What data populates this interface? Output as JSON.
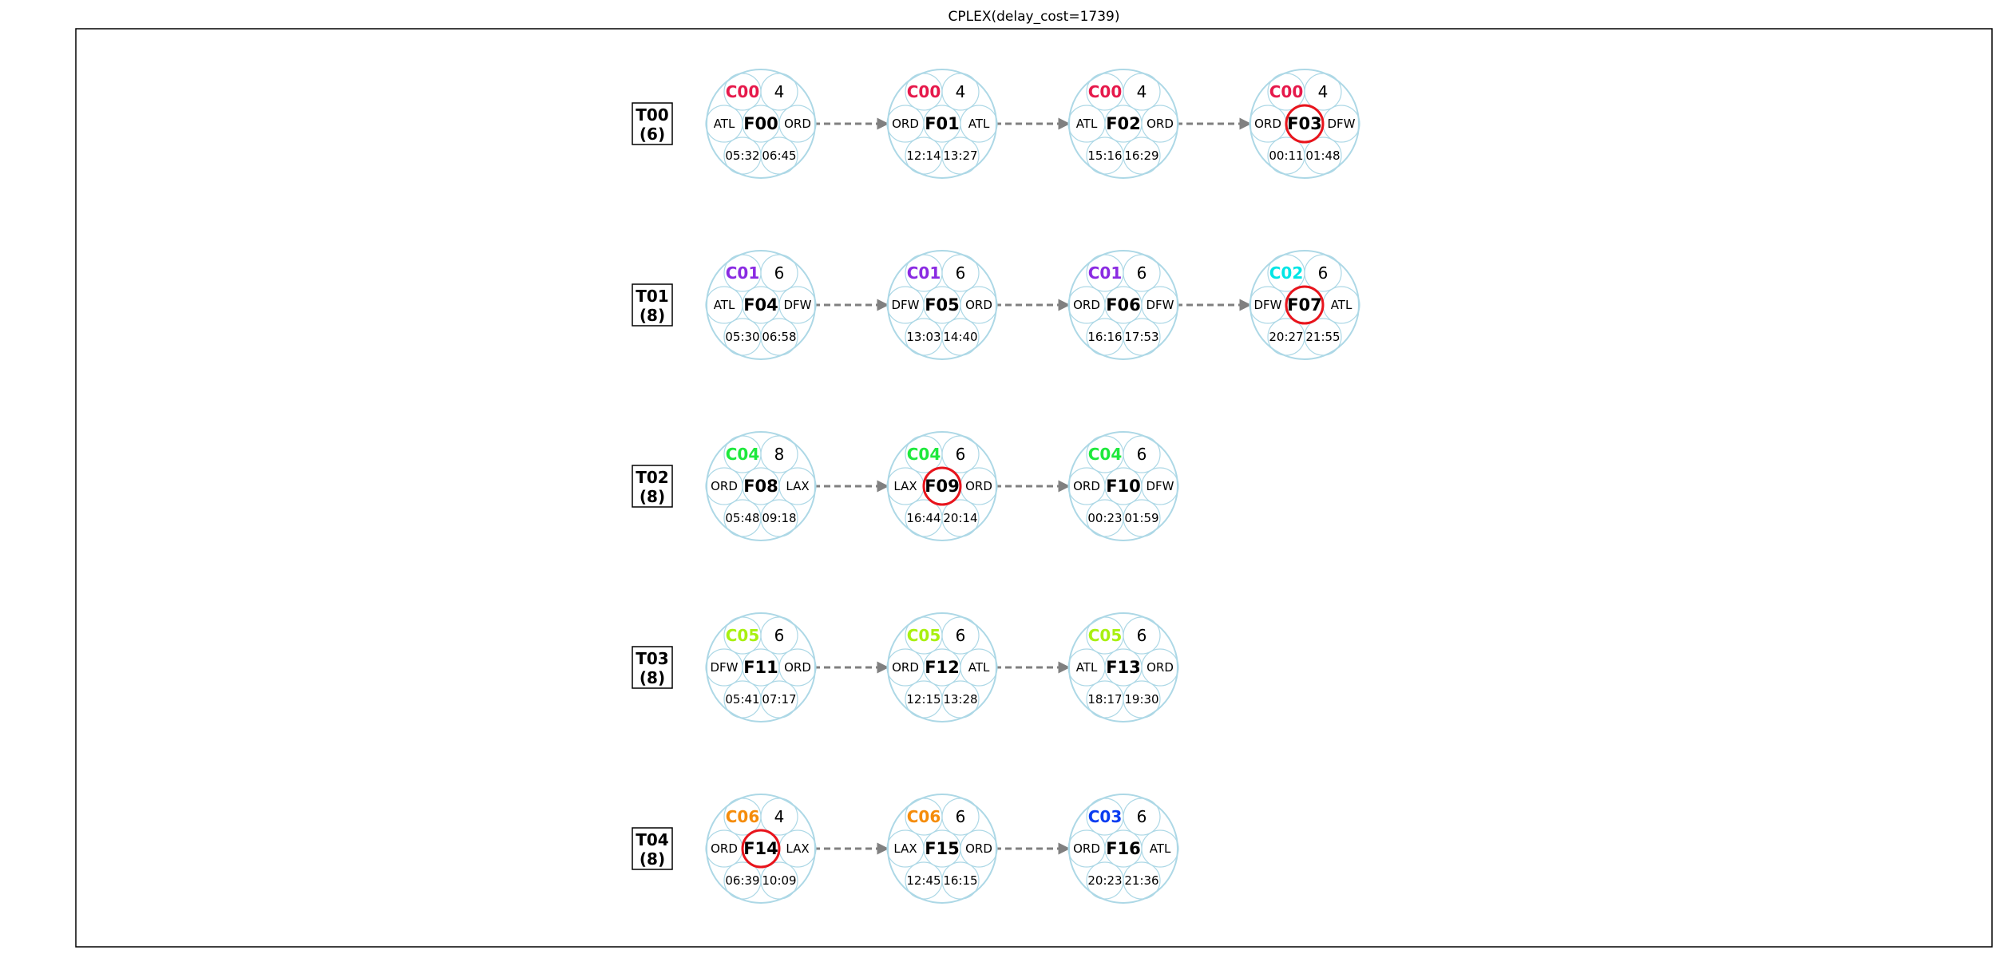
{
  "title": "CPLEX(delay_cost=1739)",
  "colors": {
    "frame": "#000000",
    "outer_circle": "#add8e6",
    "inner_circle": "#add8e6",
    "highlight_ring": "#e8141c",
    "arrow": "#808080"
  },
  "rows": [
    {
      "tail": "T00",
      "count": "(6)",
      "flights": [
        {
          "crew": "C00",
          "crew_color": "#e6194b",
          "num": "4",
          "id": "F00",
          "from": "ATL",
          "to": "ORD",
          "dep": "05:32",
          "arr": "06:45",
          "highlight": false
        },
        {
          "crew": "C00",
          "crew_color": "#e6194b",
          "num": "4",
          "id": "F01",
          "from": "ORD",
          "to": "ATL",
          "dep": "12:14",
          "arr": "13:27",
          "highlight": false
        },
        {
          "crew": "C00",
          "crew_color": "#e6194b",
          "num": "4",
          "id": "F02",
          "from": "ATL",
          "to": "ORD",
          "dep": "15:16",
          "arr": "16:29",
          "highlight": false
        },
        {
          "crew": "C00",
          "crew_color": "#e6194b",
          "num": "4",
          "id": "F03",
          "from": "ORD",
          "to": "DFW",
          "dep": "00:11",
          "arr": "01:48",
          "highlight": true
        }
      ]
    },
    {
      "tail": "T01",
      "count": "(8)",
      "flights": [
        {
          "crew": "C01",
          "crew_color": "#8a2be2",
          "num": "6",
          "id": "F04",
          "from": "ATL",
          "to": "DFW",
          "dep": "05:30",
          "arr": "06:58",
          "highlight": false
        },
        {
          "crew": "C01",
          "crew_color": "#8a2be2",
          "num": "6",
          "id": "F05",
          "from": "DFW",
          "to": "ORD",
          "dep": "13:03",
          "arr": "14:40",
          "highlight": false
        },
        {
          "crew": "C01",
          "crew_color": "#8a2be2",
          "num": "6",
          "id": "F06",
          "from": "ORD",
          "to": "DFW",
          "dep": "16:16",
          "arr": "17:53",
          "highlight": false
        },
        {
          "crew": "C02",
          "crew_color": "#00e5e5",
          "num": "6",
          "id": "F07",
          "from": "DFW",
          "to": "ATL",
          "dep": "20:27",
          "arr": "21:55",
          "highlight": true
        }
      ]
    },
    {
      "tail": "T02",
      "count": "(8)",
      "flights": [
        {
          "crew": "C04",
          "crew_color": "#1ee83c",
          "num": "8",
          "id": "F08",
          "from": "ORD",
          "to": "LAX",
          "dep": "05:48",
          "arr": "09:18",
          "highlight": false
        },
        {
          "crew": "C04",
          "crew_color": "#1ee83c",
          "num": "6",
          "id": "F09",
          "from": "LAX",
          "to": "ORD",
          "dep": "16:44",
          "arr": "20:14",
          "highlight": true
        },
        {
          "crew": "C04",
          "crew_color": "#1ee83c",
          "num": "6",
          "id": "F10",
          "from": "ORD",
          "to": "DFW",
          "dep": "00:23",
          "arr": "01:59",
          "highlight": false
        }
      ]
    },
    {
      "tail": "T03",
      "count": "(8)",
      "flights": [
        {
          "crew": "C05",
          "crew_color": "#a8f010",
          "num": "6",
          "id": "F11",
          "from": "DFW",
          "to": "ORD",
          "dep": "05:41",
          "arr": "07:17",
          "highlight": false
        },
        {
          "crew": "C05",
          "crew_color": "#a8f010",
          "num": "6",
          "id": "F12",
          "from": "ORD",
          "to": "ATL",
          "dep": "12:15",
          "arr": "13:28",
          "highlight": false
        },
        {
          "crew": "C05",
          "crew_color": "#a8f010",
          "num": "6",
          "id": "F13",
          "from": "ATL",
          "to": "ORD",
          "dep": "18:17",
          "arr": "19:30",
          "highlight": false
        }
      ]
    },
    {
      "tail": "T04",
      "count": "(8)",
      "flights": [
        {
          "crew": "C06",
          "crew_color": "#f58c0a",
          "num": "4",
          "id": "F14",
          "from": "ORD",
          "to": "LAX",
          "dep": "06:39",
          "arr": "10:09",
          "highlight": true
        },
        {
          "crew": "C06",
          "crew_color": "#f58c0a",
          "num": "6",
          "id": "F15",
          "from": "LAX",
          "to": "ORD",
          "dep": "12:45",
          "arr": "16:15",
          "highlight": false
        },
        {
          "crew": "C03",
          "crew_color": "#0a3cf0",
          "num": "6",
          "id": "F16",
          "from": "ORD",
          "to": "ATL",
          "dep": "20:23",
          "arr": "21:36",
          "highlight": false
        }
      ]
    }
  ]
}
